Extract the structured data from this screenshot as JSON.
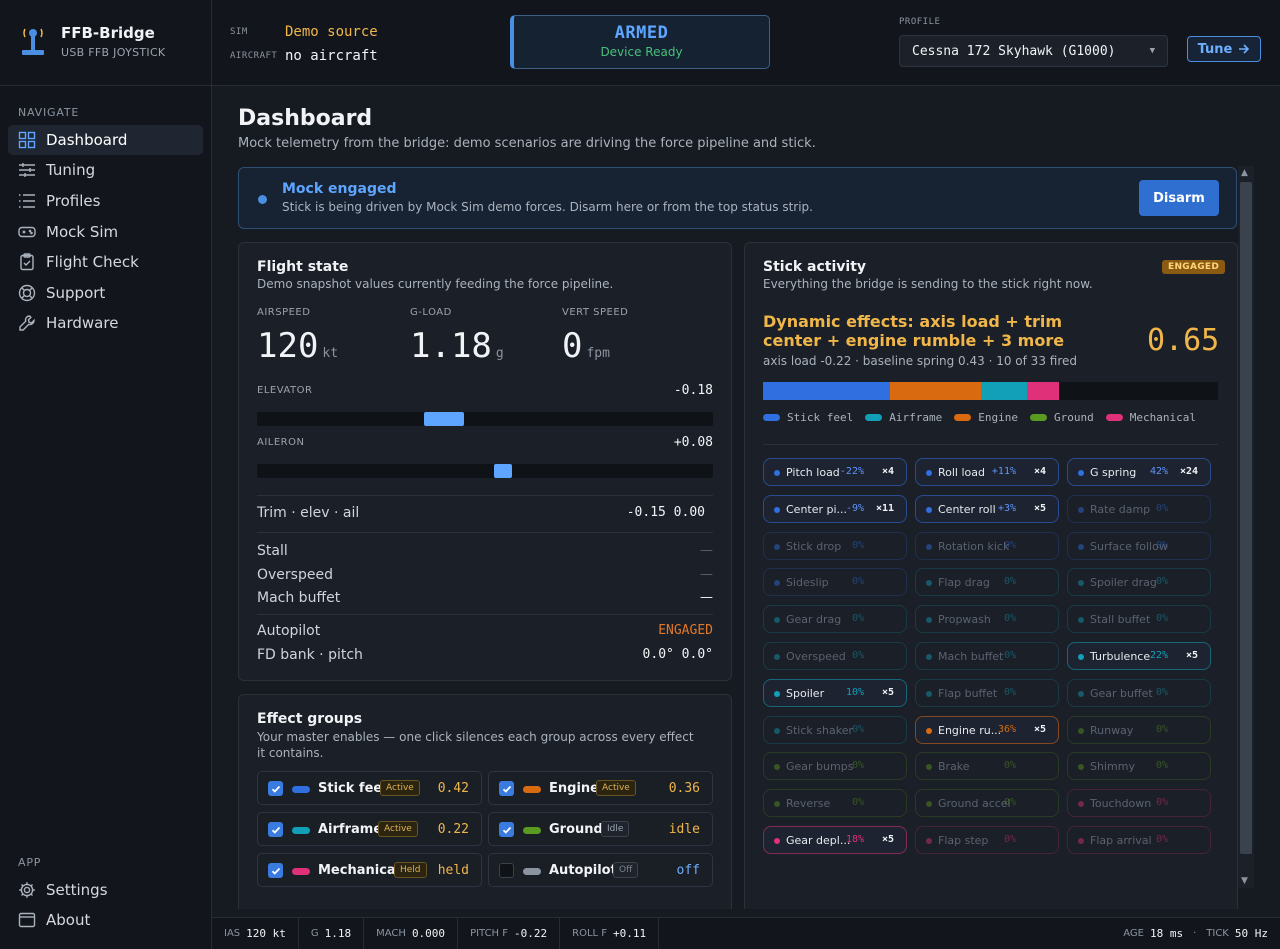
{
  "brand": {
    "name": "FFB-Bridge",
    "subtitle": "USB FFB JOYSTICK"
  },
  "header": {
    "sim_label": "SIM",
    "sim_value": "Demo source",
    "aircraft_label": "AIRCRAFT",
    "aircraft_value": "no aircraft",
    "armed_title": "ARMED",
    "armed_status": "Device Ready",
    "profile_label": "PROFILE",
    "profile_value": "Cessna 172 Skyhawk (G1000)",
    "tune_label": "Tune"
  },
  "sidebar": {
    "navigate_label": "NAVIGATE",
    "items": [
      {
        "label": "Dashboard",
        "icon": "dashboard-icon",
        "active": true
      },
      {
        "label": "Tuning",
        "icon": "sliders-icon"
      },
      {
        "label": "Profiles",
        "icon": "list-icon"
      },
      {
        "label": "Mock Sim",
        "icon": "gamepad-icon"
      },
      {
        "label": "Flight Check",
        "icon": "clipboard-check-icon"
      },
      {
        "label": "Support",
        "icon": "lifebuoy-icon"
      },
      {
        "label": "Hardware",
        "icon": "wrench-icon"
      }
    ],
    "app_label": "APP",
    "app_items": [
      {
        "label": "Settings",
        "icon": "gear-icon"
      },
      {
        "label": "About",
        "icon": "window-icon"
      }
    ]
  },
  "page": {
    "title": "Dashboard",
    "description": "Mock telemetry from the bridge: demo scenarios are driving the force pipeline and stick."
  },
  "banner": {
    "title": "Mock engaged",
    "text": "Stick is being driven by Mock Sim demo forces. Disarm here or from the top status strip.",
    "button": "Disarm"
  },
  "flight_state": {
    "title": "Flight state",
    "description": "Demo snapshot values currently feeding the force pipeline.",
    "airspeed_label": "AIRSPEED",
    "airspeed_value": "120",
    "airspeed_unit": "kt",
    "gload_label": "G-LOAD",
    "gload_value": "1.18",
    "gload_unit": "g",
    "vs_label": "VERT SPEED",
    "vs_value": "0",
    "vs_unit": "fpm",
    "elevator_label": "ELEVATOR",
    "elevator_value": "-0.18",
    "elevator_position": -0.18,
    "aileron_label": "AILERON",
    "aileron_value": "+0.08",
    "aileron_position": 0.08,
    "trim_label": "Trim · elev · ail",
    "trim_value": "-0.15 0.00",
    "stall_label": "Stall",
    "stall_value": "—",
    "overspeed_label": "Overspeed",
    "overspeed_value": "—",
    "mach_label": "Mach buffet",
    "mach_value": "—",
    "autopilot_label": "Autopilot",
    "autopilot_value": "ENGAGED",
    "fd_label": "FD bank · pitch",
    "fd_value": "0.0° 0.0°"
  },
  "effect_groups": {
    "title": "Effect groups",
    "description": "Your master enables — one click silences each group across every effect it contains.",
    "groups": [
      {
        "name": "Stick feel",
        "badge": "Active",
        "value": "0.42",
        "color": "#2f6fe0",
        "checked": true
      },
      {
        "name": "Engine",
        "badge": "Active",
        "value": "0.36",
        "color": "#d96a10",
        "checked": true
      },
      {
        "name": "Airframe",
        "badge": "Active",
        "value": "0.22",
        "color": "#12a0b8",
        "checked": true
      },
      {
        "name": "Ground",
        "badge": "Idle",
        "value": "idle",
        "color": "#5a9a20",
        "checked": true
      },
      {
        "name": "Mechanical",
        "badge": "Held",
        "value": "held",
        "color": "#e0307a",
        "checked": true
      },
      {
        "name": "Autopilot",
        "badge": "Off",
        "value": "off",
        "color": "#8b94a0",
        "checked": false
      }
    ]
  },
  "stick_activity": {
    "title": "Stick activity",
    "description": "Everything the bridge is sending to the stick right now.",
    "badge": "ENGAGED",
    "headline": "Dynamic effects: axis load + trim center + engine rumble + 3 more",
    "big_value": "0.65",
    "detail": "axis load -0.22 · baseline spring 0.43 · 10 of 33 fired",
    "bar": [
      {
        "name": "Stick feel",
        "share": 0.28,
        "color": "#2f6fe0"
      },
      {
        "name": "Engine",
        "share": 0.2,
        "color": "#d96a10"
      },
      {
        "name": "Airframe",
        "share": 0.1,
        "color": "#12a0b8"
      },
      {
        "name": "Mechanical",
        "share": 0.07,
        "color": "#e0307a"
      }
    ],
    "legend": [
      {
        "name": "Stick feel",
        "color": "#2f6fe0"
      },
      {
        "name": "Airframe",
        "color": "#12a0b8"
      },
      {
        "name": "Engine",
        "color": "#d96a10"
      },
      {
        "name": "Ground",
        "color": "#5a9a20"
      },
      {
        "name": "Mechanical",
        "color": "#e0307a"
      }
    ],
    "effects": [
      {
        "name": "Pitch load",
        "pct": "-22%",
        "count": "×4",
        "color": "#2f6fe0",
        "on": true
      },
      {
        "name": "Roll load",
        "pct": "+11%",
        "count": "×4",
        "color": "#2f6fe0",
        "on": true
      },
      {
        "name": "G spring",
        "pct": "42%",
        "count": "×24",
        "color": "#2f6fe0",
        "on": true
      },
      {
        "name": "Center pi...",
        "pct": "-9%",
        "count": "×11",
        "color": "#2f6fe0",
        "on": true
      },
      {
        "name": "Center roll",
        "pct": "+3%",
        "count": "×5",
        "color": "#2f6fe0",
        "on": true
      },
      {
        "name": "Rate damp",
        "pct": "0%",
        "count": "",
        "color": "#2f6fe0",
        "on": false
      },
      {
        "name": "Stick drop",
        "pct": "0%",
        "count": "",
        "color": "#2f6fe0",
        "on": false
      },
      {
        "name": "Rotation kick",
        "pct": "0%",
        "count": "",
        "color": "#2f6fe0",
        "on": false
      },
      {
        "name": "Surface follow",
        "pct": "0%",
        "count": "",
        "color": "#2f6fe0",
        "on": false
      },
      {
        "name": "Sideslip",
        "pct": "0%",
        "count": "",
        "color": "#2f6fe0",
        "on": false
      },
      {
        "name": "Flap drag",
        "pct": "0%",
        "count": "",
        "color": "#12a0b8",
        "on": false
      },
      {
        "name": "Spoiler drag",
        "pct": "0%",
        "count": "",
        "color": "#12a0b8",
        "on": false
      },
      {
        "name": "Gear drag",
        "pct": "0%",
        "count": "",
        "color": "#12a0b8",
        "on": false
      },
      {
        "name": "Propwash",
        "pct": "0%",
        "count": "",
        "color": "#12a0b8",
        "on": false
      },
      {
        "name": "Stall buffet",
        "pct": "0%",
        "count": "",
        "color": "#12a0b8",
        "on": false
      },
      {
        "name": "Overspeed",
        "pct": "0%",
        "count": "",
        "color": "#12a0b8",
        "on": false
      },
      {
        "name": "Mach buffet",
        "pct": "0%",
        "count": "",
        "color": "#12a0b8",
        "on": false
      },
      {
        "name": "Turbulence",
        "pct": "22%",
        "count": "×5",
        "color": "#12a0b8",
        "on": true
      },
      {
        "name": "Spoiler",
        "pct": "10%",
        "count": "×5",
        "color": "#12a0b8",
        "on": true
      },
      {
        "name": "Flap buffet",
        "pct": "0%",
        "count": "",
        "color": "#12a0b8",
        "on": false
      },
      {
        "name": "Gear buffet",
        "pct": "0%",
        "count": "",
        "color": "#12a0b8",
        "on": false
      },
      {
        "name": "Stick shaker",
        "pct": "0%",
        "count": "",
        "color": "#12a0b8",
        "on": false
      },
      {
        "name": "Engine ru...",
        "pct": "36%",
        "count": "×5",
        "color": "#d96a10",
        "on": true
      },
      {
        "name": "Runway",
        "pct": "0%",
        "count": "",
        "color": "#5a9a20",
        "on": false
      },
      {
        "name": "Gear bumps",
        "pct": "0%",
        "count": "",
        "color": "#5a9a20",
        "on": false
      },
      {
        "name": "Brake",
        "pct": "0%",
        "count": "",
        "color": "#5a9a20",
        "on": false
      },
      {
        "name": "Shimmy",
        "pct": "0%",
        "count": "",
        "color": "#5a9a20",
        "on": false
      },
      {
        "name": "Reverse",
        "pct": "0%",
        "count": "",
        "color": "#5a9a20",
        "on": false
      },
      {
        "name": "Ground accel",
        "pct": "0%",
        "count": "",
        "color": "#5a9a20",
        "on": false
      },
      {
        "name": "Touchdown",
        "pct": "0%",
        "count": "",
        "color": "#e0307a",
        "on": false
      },
      {
        "name": "Gear depl...",
        "pct": "18%",
        "count": "×5",
        "color": "#e0307a",
        "on": true
      },
      {
        "name": "Flap step",
        "pct": "0%",
        "count": "",
        "color": "#e0307a",
        "on": false
      },
      {
        "name": "Flap arrival",
        "pct": "0%",
        "count": "",
        "color": "#e0307a",
        "on": false
      }
    ]
  },
  "statusbar": {
    "ias_label": "IAS",
    "ias_value": "120 kt",
    "g_label": "G",
    "g_value": "1.18",
    "mach_label": "MACH",
    "mach_value": "0.000",
    "pitch_label": "PITCH F",
    "pitch_value": "-0.22",
    "roll_label": "ROLL F",
    "roll_value": "+0.11",
    "age_label": "AGE",
    "age_value": "18 ms",
    "tick_label": "TICK",
    "tick_value": "50 Hz"
  },
  "colors": {
    "accent": "#4a8fe2",
    "warning": "#f0b64a",
    "success": "#47c07a",
    "engaged": "#e0782a"
  }
}
